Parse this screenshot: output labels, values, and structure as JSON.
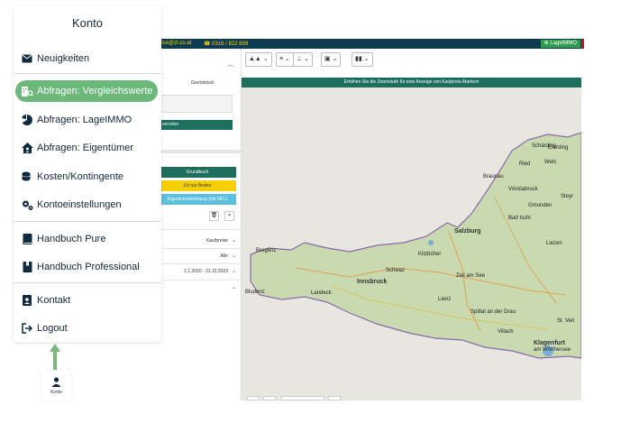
{
  "topbar": {
    "contact": "ffice@zt.co.at",
    "phone": "0316 / 822 899",
    "brand": "LageIMMO"
  },
  "leftpanel": {
    "grundstueck_label": "Grundstück",
    "verorten_label": "verorten",
    "buttons": {
      "grundbuch": "Grundbuch",
      "ln_nur_boden": "LN nur Boden",
      "eigentumswohnung": "Eigentumswohnung (mit NFL)"
    },
    "rows": {
      "kaufpreise": "Kaufpreise",
      "alle": "Alle",
      "zeitraum": "1.1.2020 - 31.12.2023"
    }
  },
  "map": {
    "notice": "Erhöhen Sie die Zoomstufe für eine Anzeige von Kaufpreis-Markern",
    "labels": {
      "salzburg": "Salzburg",
      "bregenz": "Bregenz",
      "innsbruck": "Innsbruck",
      "landeck": "Landeck",
      "klagenfurt": "Klagenfurt",
      "woerthersee": "am Wörthersee",
      "villach": "Villach",
      "schwaz": "Schwaz",
      "kitzbuehel": "Kitzbühel",
      "bad_ischl": "Bad Ischl",
      "zell_am_see": "Zell am See",
      "bludenz": "Bludenz",
      "wels": "Wels",
      "vocklabruck": "Vöcklabruck",
      "steyr": "Steyr",
      "spittal": "Spittal an der Drau",
      "st_veit": "St. Veit",
      "lienz": "Lienz",
      "gmunden": "Gmunden",
      "liezen": "Liezen",
      "braunau": "Braunau",
      "eferding": "Eferding",
      "ried": "Ried",
      "schaerding": "Schärding"
    }
  },
  "menu": {
    "title": "Konto",
    "items": [
      {
        "label": "Neuigkeiten",
        "icon": "envelope-icon"
      },
      {
        "label": "Abfragen: Vergleichswerte",
        "icon": "building-search-icon"
      },
      {
        "label": "Abfragen: LageIMMO",
        "icon": "pie-chart-icon"
      },
      {
        "label": "Abfragen: Eigentümer",
        "icon": "house-user-icon"
      },
      {
        "label": "Kosten/Kontingente",
        "icon": "coins-icon"
      },
      {
        "label": "Kontoeinstellungen",
        "icon": "gears-icon"
      },
      {
        "label": "Handbuch Pure",
        "icon": "book-icon"
      },
      {
        "label": "Handbuch Professional",
        "icon": "book-bookmark-icon"
      },
      {
        "label": "Kontakt",
        "icon": "address-book-icon"
      },
      {
        "label": "Logout",
        "icon": "logout-icon"
      }
    ]
  },
  "nav": {
    "konto_label": "Konto"
  },
  "colors": {
    "primary_dark": "#0d3b4f",
    "accent_green": "#1d6e5c",
    "menu_active": "#6cb87a",
    "arrow_green": "#78b87a"
  }
}
